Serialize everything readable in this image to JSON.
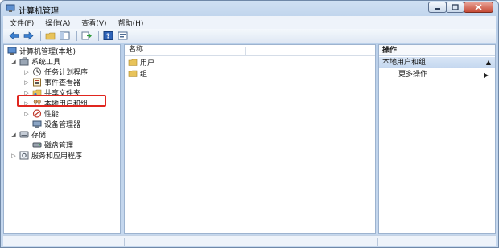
{
  "window": {
    "title": "计算机管理"
  },
  "menubar": {
    "items": [
      "文件(F)",
      "操作(A)",
      "查看(V)",
      "帮助(H)"
    ]
  },
  "toolbar": {
    "icons": [
      "back-arrow-icon",
      "forward-arrow-icon",
      "folder-up-icon",
      "show-hide-tree-icon",
      "export-list-icon",
      "help-icon",
      "properties-icon"
    ]
  },
  "tree": {
    "root": "计算机管理(本地)",
    "system_tools": "系统工具",
    "task_scheduler": "任务计划程序",
    "event_viewer": "事件查看器",
    "shared_folders": "共享文件夹",
    "local_users_groups": "本地用户和组",
    "performance": "性能",
    "device_manager": "设备管理器",
    "storage": "存储",
    "disk_management": "磁盘管理",
    "services_apps": "服务和应用程序"
  },
  "list": {
    "column_name": "名称",
    "items": [
      "用户",
      "组"
    ]
  },
  "actions": {
    "title": "操作",
    "section": "本地用户和组",
    "more": "更多操作"
  },
  "colors": {
    "highlight": "#e0261f",
    "folder": "#e8c35a",
    "accent": "#1f5fa8"
  }
}
